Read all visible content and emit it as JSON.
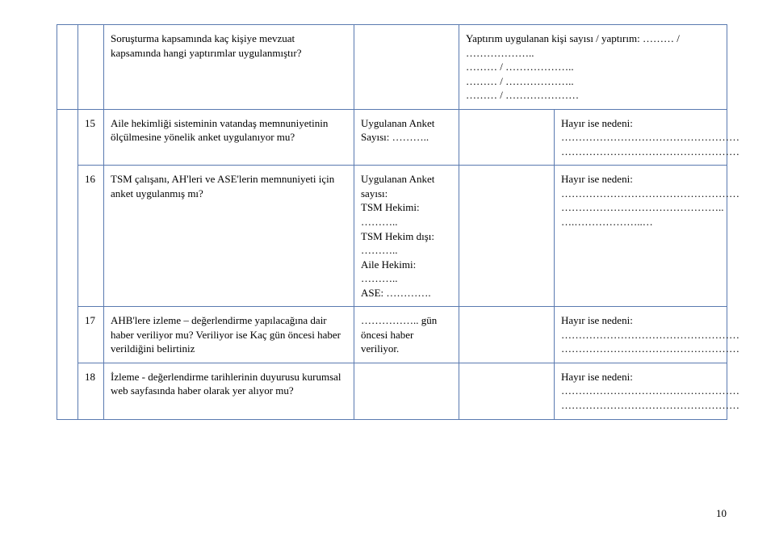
{
  "rows": {
    "r0": {
      "question": "Soruşturma kapsamında kaç kişiye mevzuat kapsamında hangi yaptırımlar uygulanmıştır?",
      "col4": "Yaptırım uygulanan kişi sayısı / yaptırım: ……… / ………………..\n……… / ………………..\n……… / ………………..\n……… / …………………"
    },
    "r15": {
      "num": "15",
      "question": "Aile hekimliği sisteminin vatandaş memnuniyetinin ölçülmesine yönelik anket uygulanıyor mu?",
      "col3": "Uygulanan Anket Sayısı: ………..",
      "col5": "Hayır ise nedeni:\n……………………………………………\n……………………………………………"
    },
    "r16": {
      "num": "16",
      "question": "TSM çalışanı, AH'leri ve ASE'lerin memnuniyeti için anket uygulanmış mı?",
      "col3": "Uygulanan Anket sayısı:\nTSM Hekimi: ………..\nTSM Hekim dışı: ………..\nAile Hekimi: ………..\nASE: ………….",
      "col5": "Hayır ise nedeni:\n……………………………………………\n………………………………………..\n….………………..…"
    },
    "r17": {
      "num": "17",
      "question": "AHB'lere izleme – değerlendirme yapılacağına dair haber veriliyor mu? Veriliyor ise Kaç gün öncesi haber verildiğini belirtiniz",
      "col3": "…………….. gün öncesi haber veriliyor.",
      "col5": "Hayır ise nedeni:\n……………………………………………\n……………………………………………"
    },
    "r18": {
      "num": "18",
      "question": "İzleme - değerlendirme tarihlerinin duyurusu kurumsal web sayfasında haber olarak yer alıyor mu?",
      "col5": "Hayır ise nedeni:\n……………………………………………\n……………………………………………"
    }
  },
  "pageNumber": "10"
}
